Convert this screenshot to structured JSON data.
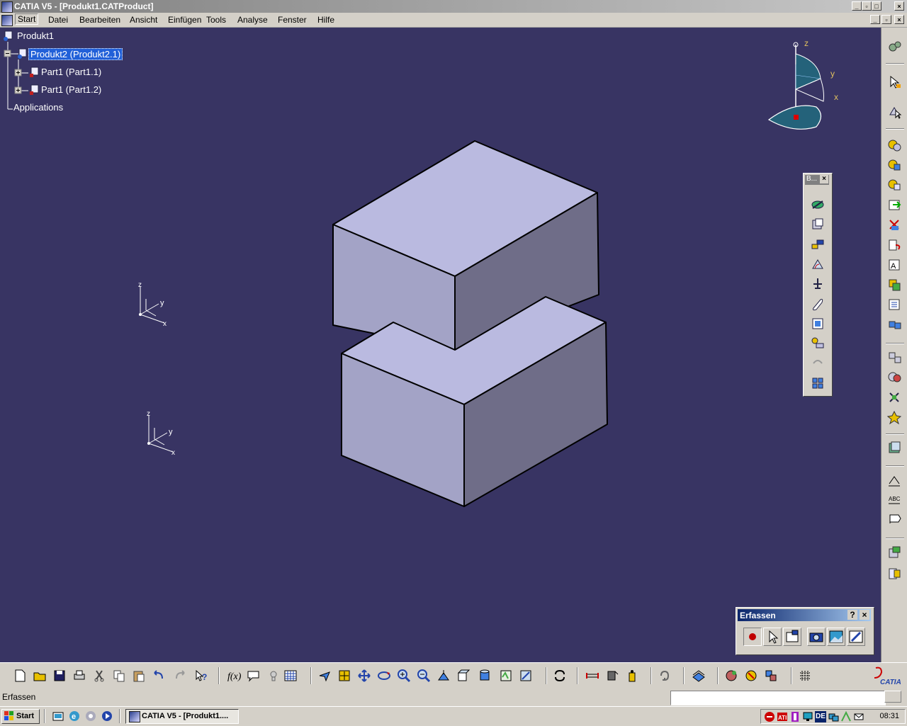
{
  "window": {
    "title": "CATIA V5 - [Produkt1.CATProduct]"
  },
  "menu": {
    "items": [
      "Start",
      "Datei",
      "Bearbeiten",
      "Ansicht",
      "Einfügen",
      "Tools",
      "Analyse",
      "Fenster",
      "Hilfe"
    ],
    "active": "Start"
  },
  "tree": {
    "root": "Produkt1",
    "child": "Produkt2 (Produkt2.1)",
    "parts": [
      "Part1 (Part1.1)",
      "Part1 (Part1.2)"
    ],
    "applications": "Applications"
  },
  "compass": {
    "z": "z",
    "y": "y",
    "x": "x"
  },
  "axes": [
    {
      "z": "z",
      "y": "y",
      "x": "x"
    },
    {
      "z": "z",
      "y": "y",
      "x": "x"
    }
  ],
  "float_toolbar": {
    "title": "B..."
  },
  "erfassen": {
    "title": "Erfassen",
    "help": "?",
    "close": "×"
  },
  "status": {
    "text": "Erfassen",
    "input_value": ""
  },
  "taskbar": {
    "start": "Start",
    "task": "CATIA V5 - [Produkt1....",
    "clock": "08:31",
    "lang": "DE"
  },
  "brand": {
    "logo_text": "CATIA"
  },
  "colors": {
    "viewport_bg": "#383463",
    "face_top": "#babae0",
    "face_left": "#a3a3c6",
    "face_right": "#6f6d88",
    "selection": "#2160d8"
  }
}
